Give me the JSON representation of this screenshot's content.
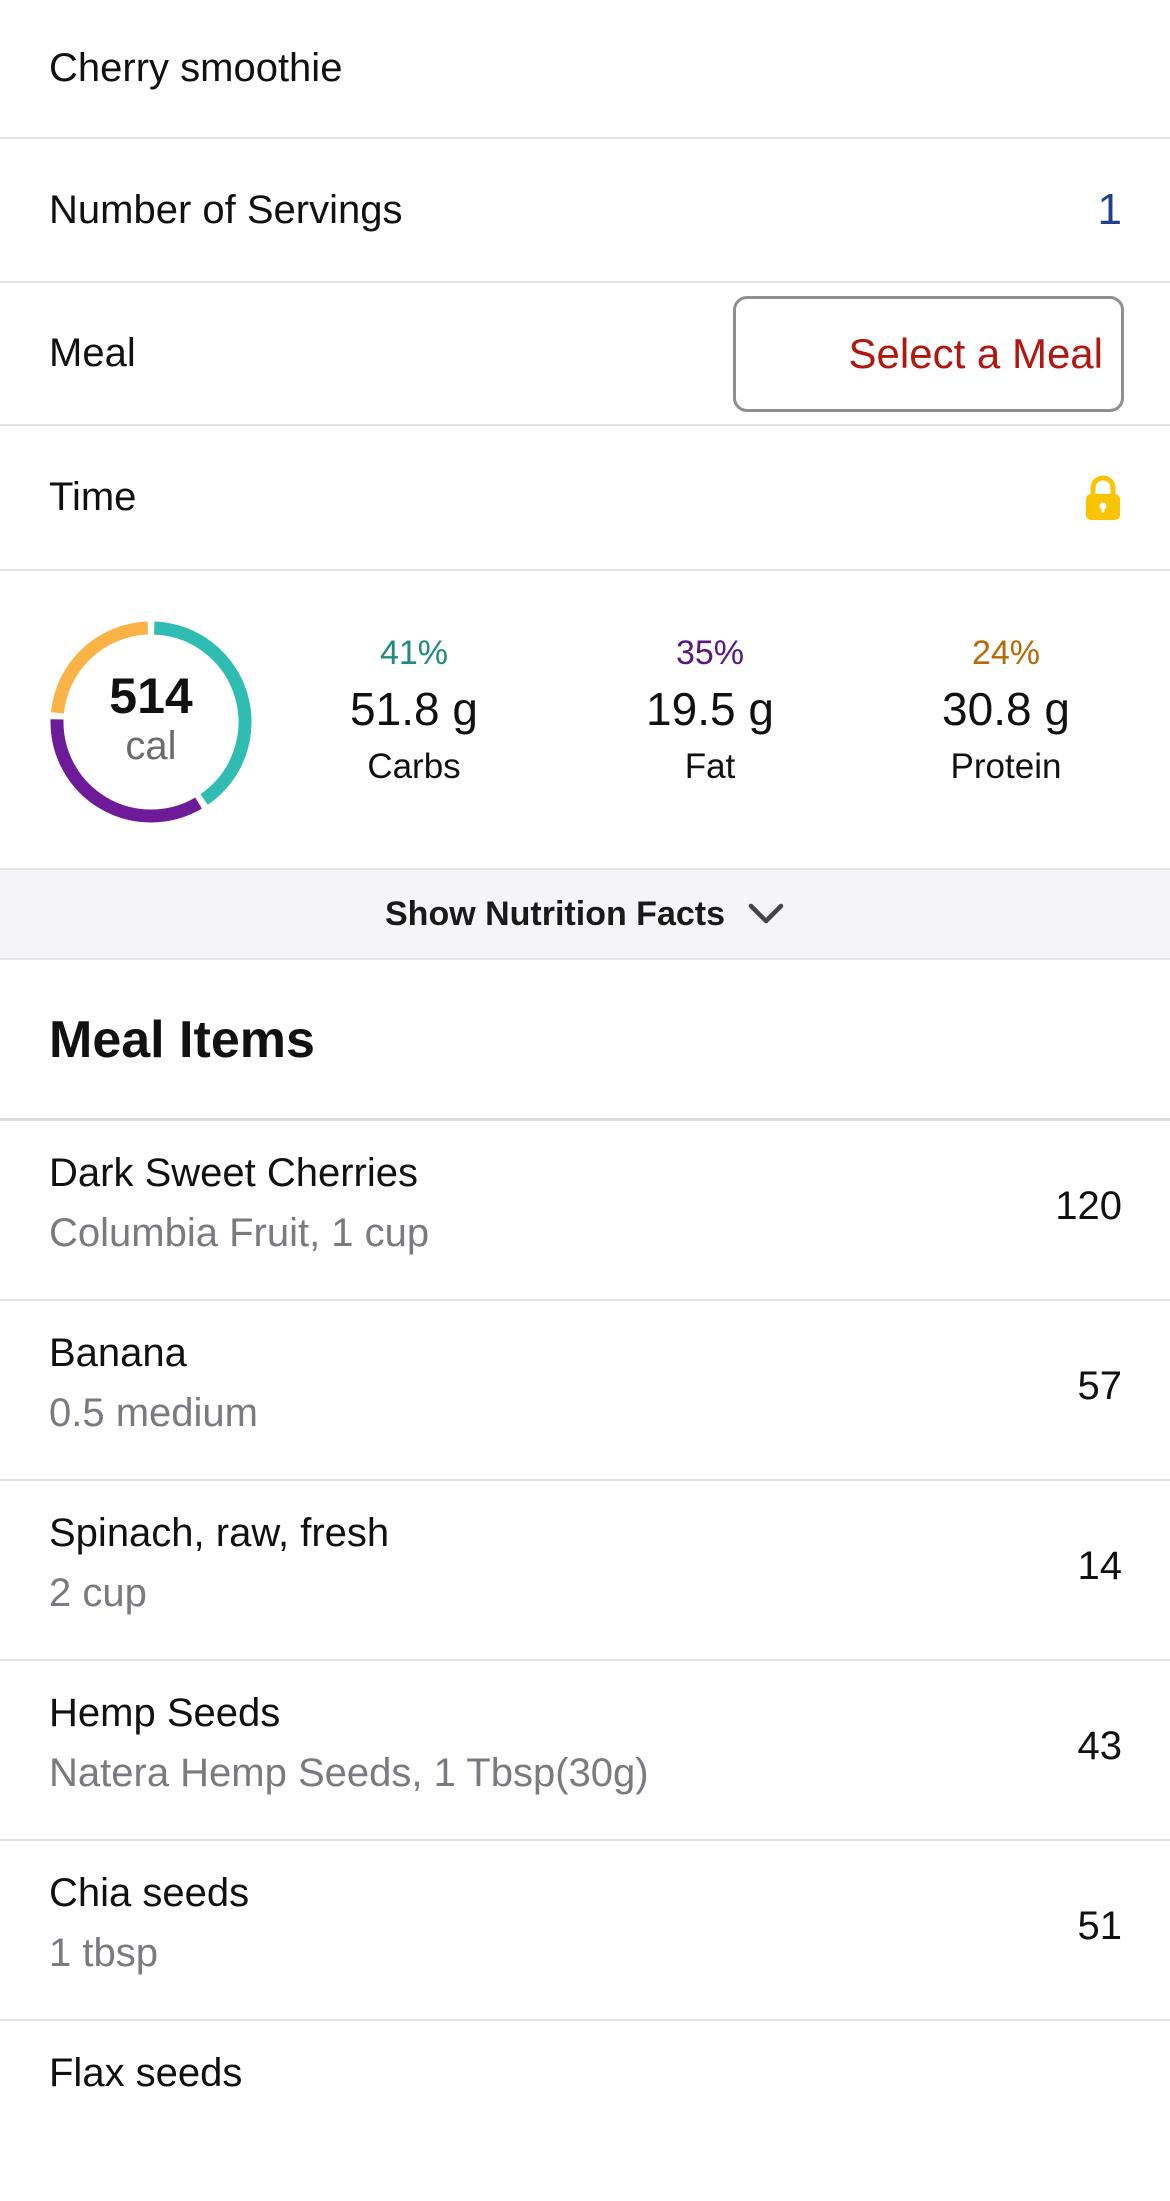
{
  "entry": {
    "name": "Cherry smoothie",
    "servings_label": "Number of Servings",
    "servings_value": "1",
    "meal_label": "Meal",
    "meal_select": "Select a Meal",
    "time_label": "Time",
    "time_icon": "lock-icon"
  },
  "summary": {
    "calories": "514",
    "calories_unit": "cal",
    "ring": [
      {
        "name": "Carbs",
        "fraction": 0.41,
        "color": "#2fbcb3"
      },
      {
        "name": "Fat",
        "fraction": 0.35,
        "color": "#6d1b98"
      },
      {
        "name": "Protein",
        "fraction": 0.24,
        "color": "#fbb347"
      }
    ],
    "macros": {
      "carbs": {
        "pct": "41%",
        "grams": "51.8 g",
        "label": "Carbs",
        "color": "#1f8a80"
      },
      "fat": {
        "pct": "35%",
        "grams": "19.5 g",
        "label": "Fat",
        "color": "#5b1782"
      },
      "protein": {
        "pct": "24%",
        "grams": "30.8 g",
        "label": "Protein",
        "color": "#b36b08"
      }
    }
  },
  "nutrition_toggle": {
    "label": "Show Nutrition Facts",
    "icon": "chevron-down-icon"
  },
  "meal_items": {
    "title": "Meal Items",
    "items": [
      {
        "name": "Dark Sweet Cherries",
        "detail": "Columbia Fruit, 1 cup",
        "calories": "120"
      },
      {
        "name": "Banana",
        "detail": "0.5 medium",
        "calories": "57"
      },
      {
        "name": "Spinach, raw, fresh",
        "detail": "2 cup",
        "calories": "14"
      },
      {
        "name": "Hemp Seeds",
        "detail": "Natera Hemp Seeds, 1 Tbsp(30g)",
        "calories": "43"
      },
      {
        "name": "Chia seeds",
        "detail": "1 tbsp",
        "calories": "51"
      },
      {
        "name": "Flax seeds",
        "detail": "",
        "calories": ""
      }
    ]
  },
  "colors": {
    "accent_red": "#b3160f",
    "accent_blue": "#1f3f8f",
    "lock_yellow": "#fbc400"
  }
}
